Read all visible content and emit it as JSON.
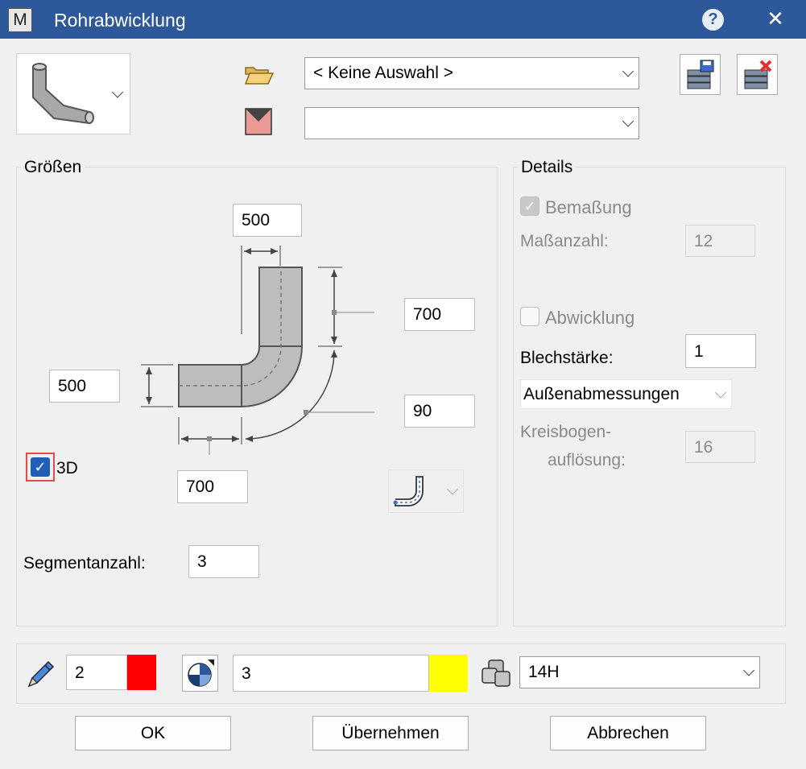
{
  "window": {
    "title": "Rohrabwicklung",
    "app_icon_letter": "M"
  },
  "toolbar": {
    "file_combo_value": "< Keine Auswahl >",
    "layer_combo_value": ""
  },
  "sizes": {
    "legend": "Größen",
    "top_width": "500",
    "right_height": "700",
    "left_height": "500",
    "angle": "90",
    "bottom_width": "700",
    "three_d_label": "3D",
    "three_d_checked": true,
    "segment_label": "Segmentanzahl:",
    "segment_value": "3"
  },
  "details": {
    "legend": "Details",
    "dimension_label": "Bemaßung",
    "dimension_checked": true,
    "dimension_count_label": "Maßanzahl:",
    "dimension_count_value": "12",
    "unfold_label": "Abwicklung",
    "unfold_checked": false,
    "thickness_label": "Blechstärke:",
    "thickness_value": "1",
    "measure_type": "Außenabmessungen",
    "arc_label_1": "Kreisbogen-",
    "arc_label_2": "auflösung:",
    "arc_value": "16"
  },
  "properties": {
    "pen_value": "2",
    "pen_color": "#ff0000",
    "line_value": "3",
    "line_color": "#ffff00",
    "layer_value": "14H"
  },
  "buttons": {
    "ok": "OK",
    "apply": "Übernehmen",
    "cancel": "Abbrechen"
  }
}
